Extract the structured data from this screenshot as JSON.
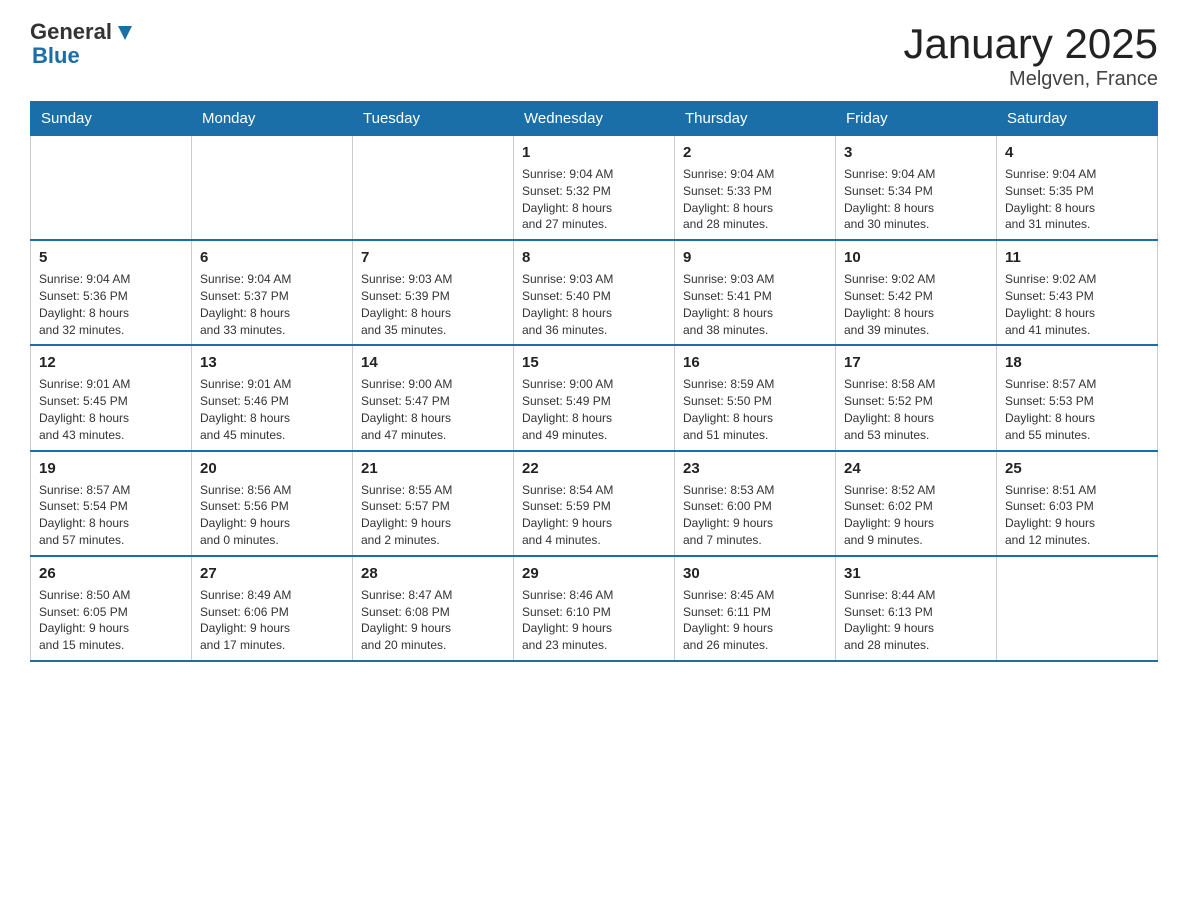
{
  "header": {
    "logo_general": "General",
    "logo_blue": "Blue",
    "title": "January 2025",
    "subtitle": "Melgven, France"
  },
  "days_of_week": [
    "Sunday",
    "Monday",
    "Tuesday",
    "Wednesday",
    "Thursday",
    "Friday",
    "Saturday"
  ],
  "weeks": [
    [
      {
        "day": "",
        "info": ""
      },
      {
        "day": "",
        "info": ""
      },
      {
        "day": "",
        "info": ""
      },
      {
        "day": "1",
        "info": "Sunrise: 9:04 AM\nSunset: 5:32 PM\nDaylight: 8 hours\nand 27 minutes."
      },
      {
        "day": "2",
        "info": "Sunrise: 9:04 AM\nSunset: 5:33 PM\nDaylight: 8 hours\nand 28 minutes."
      },
      {
        "day": "3",
        "info": "Sunrise: 9:04 AM\nSunset: 5:34 PM\nDaylight: 8 hours\nand 30 minutes."
      },
      {
        "day": "4",
        "info": "Sunrise: 9:04 AM\nSunset: 5:35 PM\nDaylight: 8 hours\nand 31 minutes."
      }
    ],
    [
      {
        "day": "5",
        "info": "Sunrise: 9:04 AM\nSunset: 5:36 PM\nDaylight: 8 hours\nand 32 minutes."
      },
      {
        "day": "6",
        "info": "Sunrise: 9:04 AM\nSunset: 5:37 PM\nDaylight: 8 hours\nand 33 minutes."
      },
      {
        "day": "7",
        "info": "Sunrise: 9:03 AM\nSunset: 5:39 PM\nDaylight: 8 hours\nand 35 minutes."
      },
      {
        "day": "8",
        "info": "Sunrise: 9:03 AM\nSunset: 5:40 PM\nDaylight: 8 hours\nand 36 minutes."
      },
      {
        "day": "9",
        "info": "Sunrise: 9:03 AM\nSunset: 5:41 PM\nDaylight: 8 hours\nand 38 minutes."
      },
      {
        "day": "10",
        "info": "Sunrise: 9:02 AM\nSunset: 5:42 PM\nDaylight: 8 hours\nand 39 minutes."
      },
      {
        "day": "11",
        "info": "Sunrise: 9:02 AM\nSunset: 5:43 PM\nDaylight: 8 hours\nand 41 minutes."
      }
    ],
    [
      {
        "day": "12",
        "info": "Sunrise: 9:01 AM\nSunset: 5:45 PM\nDaylight: 8 hours\nand 43 minutes."
      },
      {
        "day": "13",
        "info": "Sunrise: 9:01 AM\nSunset: 5:46 PM\nDaylight: 8 hours\nand 45 minutes."
      },
      {
        "day": "14",
        "info": "Sunrise: 9:00 AM\nSunset: 5:47 PM\nDaylight: 8 hours\nand 47 minutes."
      },
      {
        "day": "15",
        "info": "Sunrise: 9:00 AM\nSunset: 5:49 PM\nDaylight: 8 hours\nand 49 minutes."
      },
      {
        "day": "16",
        "info": "Sunrise: 8:59 AM\nSunset: 5:50 PM\nDaylight: 8 hours\nand 51 minutes."
      },
      {
        "day": "17",
        "info": "Sunrise: 8:58 AM\nSunset: 5:52 PM\nDaylight: 8 hours\nand 53 minutes."
      },
      {
        "day": "18",
        "info": "Sunrise: 8:57 AM\nSunset: 5:53 PM\nDaylight: 8 hours\nand 55 minutes."
      }
    ],
    [
      {
        "day": "19",
        "info": "Sunrise: 8:57 AM\nSunset: 5:54 PM\nDaylight: 8 hours\nand 57 minutes."
      },
      {
        "day": "20",
        "info": "Sunrise: 8:56 AM\nSunset: 5:56 PM\nDaylight: 9 hours\nand 0 minutes."
      },
      {
        "day": "21",
        "info": "Sunrise: 8:55 AM\nSunset: 5:57 PM\nDaylight: 9 hours\nand 2 minutes."
      },
      {
        "day": "22",
        "info": "Sunrise: 8:54 AM\nSunset: 5:59 PM\nDaylight: 9 hours\nand 4 minutes."
      },
      {
        "day": "23",
        "info": "Sunrise: 8:53 AM\nSunset: 6:00 PM\nDaylight: 9 hours\nand 7 minutes."
      },
      {
        "day": "24",
        "info": "Sunrise: 8:52 AM\nSunset: 6:02 PM\nDaylight: 9 hours\nand 9 minutes."
      },
      {
        "day": "25",
        "info": "Sunrise: 8:51 AM\nSunset: 6:03 PM\nDaylight: 9 hours\nand 12 minutes."
      }
    ],
    [
      {
        "day": "26",
        "info": "Sunrise: 8:50 AM\nSunset: 6:05 PM\nDaylight: 9 hours\nand 15 minutes."
      },
      {
        "day": "27",
        "info": "Sunrise: 8:49 AM\nSunset: 6:06 PM\nDaylight: 9 hours\nand 17 minutes."
      },
      {
        "day": "28",
        "info": "Sunrise: 8:47 AM\nSunset: 6:08 PM\nDaylight: 9 hours\nand 20 minutes."
      },
      {
        "day": "29",
        "info": "Sunrise: 8:46 AM\nSunset: 6:10 PM\nDaylight: 9 hours\nand 23 minutes."
      },
      {
        "day": "30",
        "info": "Sunrise: 8:45 AM\nSunset: 6:11 PM\nDaylight: 9 hours\nand 26 minutes."
      },
      {
        "day": "31",
        "info": "Sunrise: 8:44 AM\nSunset: 6:13 PM\nDaylight: 9 hours\nand 28 minutes."
      },
      {
        "day": "",
        "info": ""
      }
    ]
  ]
}
